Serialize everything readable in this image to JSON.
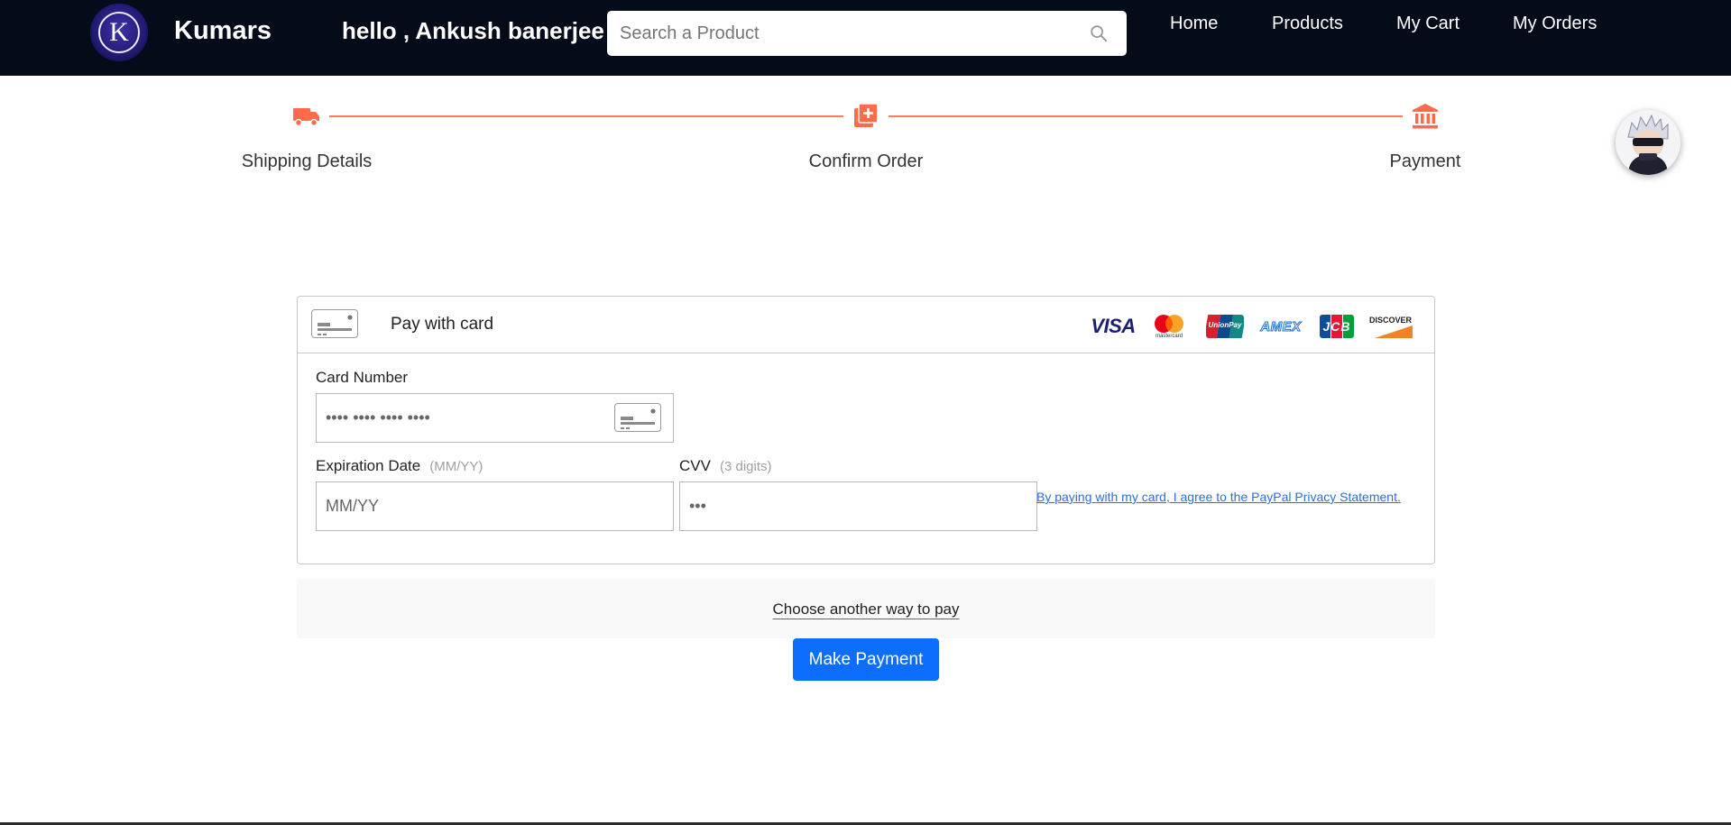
{
  "header": {
    "logo_letter": "K",
    "brand": "Kumars",
    "greeting": "hello , Ankush banerjee",
    "search_placeholder": "Search a Product",
    "nav": [
      "Home",
      "Products",
      "My Cart",
      "My Orders"
    ]
  },
  "stepper": {
    "steps": [
      "Shipping Details",
      "Confirm Order",
      "Payment"
    ],
    "accent_color": "#ff6b4a"
  },
  "payment": {
    "title": "Pay with card",
    "card_brands": [
      "VISA",
      "mastercard",
      "UnionPay",
      "AMEX",
      "JCB",
      "DISCOVER"
    ],
    "card_number_label": "Card Number",
    "card_number_placeholder": "•••• •••• •••• ••••",
    "expiry_label": "Expiration Date",
    "expiry_hint": "(MM/YY)",
    "expiry_placeholder": "MM/YY",
    "cvv_label": "CVV",
    "cvv_hint": "(3 digits)",
    "cvv_placeholder": "•••",
    "privacy_text": "By paying with my card, I agree to the PayPal Privacy Statement.",
    "alt_pay": "Choose another way to pay",
    "submit": "Make Payment"
  },
  "colors": {
    "header_bg": "#040c1a",
    "button_bg": "#0d6efd",
    "link": "#2a6fdb"
  }
}
